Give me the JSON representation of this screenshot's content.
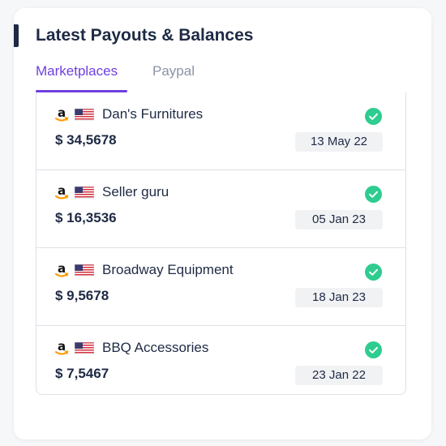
{
  "header": {
    "title": "Latest Payouts & Balances"
  },
  "tabs": [
    {
      "label": "Marketplaces",
      "active": true
    },
    {
      "label": "Paypal",
      "active": false
    }
  ],
  "colors": {
    "accent": "#6f3fe0",
    "text": "#1e2a44",
    "success": "#2ecc8f"
  },
  "payouts": [
    {
      "marketplace_icon": "amazon-icon",
      "country_icon": "us-flag-icon",
      "name": "Dan's Furnitures",
      "amount": "$ 34,5678",
      "date": "13 May 22",
      "status_icon": "check-circle-icon"
    },
    {
      "marketplace_icon": "amazon-icon",
      "country_icon": "us-flag-icon",
      "name": "Seller guru",
      "amount": "$ 16,3536",
      "date": "05 Jan 23",
      "status_icon": "check-circle-icon"
    },
    {
      "marketplace_icon": "amazon-icon",
      "country_icon": "us-flag-icon",
      "name": "Broadway Equipment",
      "amount": "$ 9,5678",
      "date": "18 Jan 23",
      "status_icon": "check-circle-icon"
    },
    {
      "marketplace_icon": "amazon-icon",
      "country_icon": "us-flag-icon",
      "name": "BBQ Accessories",
      "amount": "$ 7,5467",
      "date": "23 Jan 22",
      "status_icon": "check-circle-icon"
    }
  ]
}
